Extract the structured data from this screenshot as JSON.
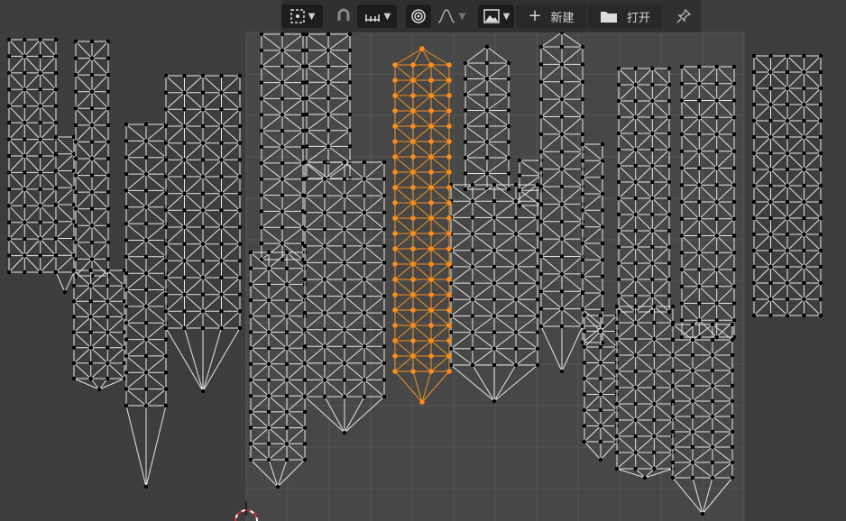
{
  "header": {
    "new_label": "新建",
    "open_label": "打开",
    "icons": {
      "pivot": "pivot-point-icon",
      "snap": "snap-magnet-icon",
      "snap_increment": "snap-increment-icon",
      "proportional": "proportional-edit-icon",
      "falloff": "falloff-curve-icon",
      "image": "image-browse-icon",
      "new": "plus-icon",
      "open": "folder-icon",
      "pin": "pin-icon"
    }
  },
  "colors": {
    "background": "#3d3d3d",
    "grid_panel": "#474747",
    "grid_line": "#545454",
    "mesh_edge": "#e6e6e6",
    "mesh_vertex": "#000000",
    "selected": "#f5921f",
    "selected_vertex": "#ff8c1a"
  }
}
